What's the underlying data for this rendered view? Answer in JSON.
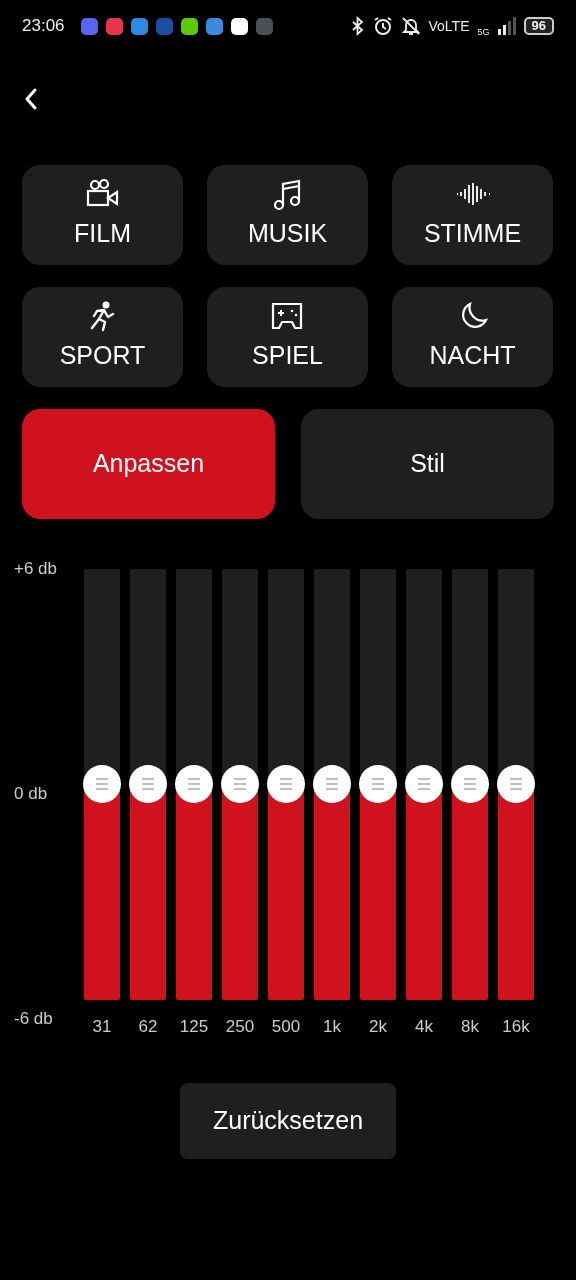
{
  "status_bar": {
    "time": "23:06",
    "network": "VoLTE",
    "generation": "5G",
    "battery": "96"
  },
  "presets": [
    {
      "label": "FILM",
      "selected": false
    },
    {
      "label": "MUSIK",
      "selected": false
    },
    {
      "label": "STIMME",
      "selected": false
    },
    {
      "label": "SPORT",
      "selected": false
    },
    {
      "label": "SPIEL",
      "selected": false
    },
    {
      "label": "NACHT",
      "selected": false
    }
  ],
  "modes": [
    {
      "label": "Anpassen",
      "selected": true
    },
    {
      "label": "Stil",
      "selected": false
    }
  ],
  "scale": [
    "+6 db",
    "0 db",
    "-6 db"
  ],
  "bands": [
    {
      "label": "31",
      "level": 0.5
    },
    {
      "label": "62",
      "level": 0.5
    },
    {
      "label": "125",
      "level": 0.5
    },
    {
      "label": "250",
      "level": 0.5
    },
    {
      "label": "500",
      "level": 0.5
    },
    {
      "label": "1k",
      "level": 0.5
    },
    {
      "label": "2k",
      "level": 0.5
    },
    {
      "label": "4k",
      "level": 0.5
    },
    {
      "label": "8k",
      "level": 0.5
    },
    {
      "label": "16k",
      "level": 0.5
    }
  ],
  "reset_button": "Zurücksetzen"
}
